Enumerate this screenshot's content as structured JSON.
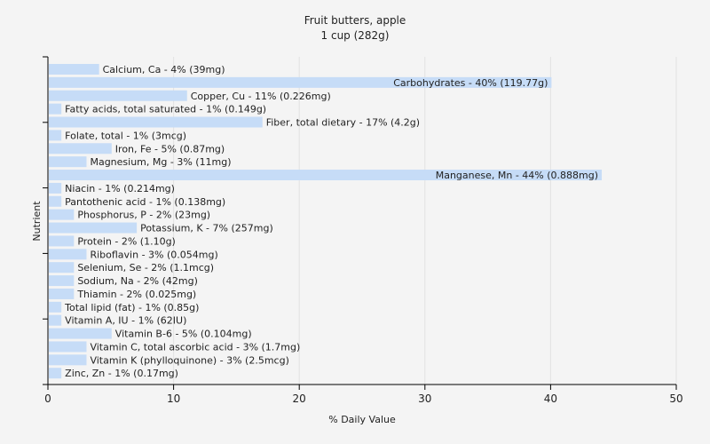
{
  "chart_data": {
    "type": "bar",
    "orientation": "horizontal",
    "title": "Fruit butters, apple",
    "subtitle": "1 cup (282g)",
    "xlabel": "% Daily Value",
    "ylabel": "Nutrient",
    "xlim": [
      0,
      50
    ],
    "xticks": [
      0,
      10,
      20,
      30,
      40,
      50
    ],
    "grid": true,
    "bar_color": "#c6dcf7",
    "categories": [
      "Calcium, Ca",
      "Carbohydrates",
      "Copper, Cu",
      "Fatty acids, total saturated",
      "Fiber, total dietary",
      "Folate, total",
      "Iron, Fe",
      "Magnesium, Mg",
      "Manganese, Mn",
      "Niacin",
      "Pantothenic acid",
      "Phosphorus, P",
      "Potassium, K",
      "Protein",
      "Riboflavin",
      "Selenium, Se",
      "Sodium, Na",
      "Thiamin",
      "Total lipid (fat)",
      "Vitamin A, IU",
      "Vitamin B-6",
      "Vitamin C, total ascorbic acid",
      "Vitamin K (phylloquinone)",
      "Zinc, Zn"
    ],
    "values": [
      4,
      40,
      11,
      1,
      17,
      1,
      5,
      3,
      44,
      1,
      1,
      2,
      7,
      2,
      3,
      2,
      2,
      2,
      1,
      1,
      5,
      3,
      3,
      1
    ],
    "labels": [
      "Calcium, Ca - 4% (39mg)",
      "Carbohydrates - 40% (119.77g)",
      "Copper, Cu - 11% (0.226mg)",
      "Fatty acids, total saturated - 1% (0.149g)",
      "Fiber, total dietary - 17% (4.2g)",
      "Folate, total - 1% (3mcg)",
      "Iron, Fe - 5% (0.87mg)",
      "Magnesium, Mg - 3% (11mg)",
      "Manganese, Mn - 44% (0.888mg)",
      "Niacin - 1% (0.214mg)",
      "Pantothenic acid - 1% (0.138mg)",
      "Phosphorus, P - 2% (23mg)",
      "Potassium, K - 7% (257mg)",
      "Protein - 2% (1.10g)",
      "Riboflavin - 3% (0.054mg)",
      "Selenium, Se - 2% (1.1mcg)",
      "Sodium, Na - 2% (42mg)",
      "Thiamin - 2% (0.025mg)",
      "Total lipid (fat) - 1% (0.85g)",
      "Vitamin A, IU - 1% (62IU)",
      "Vitamin B-6 - 5% (0.104mg)",
      "Vitamin C, total ascorbic acid - 3% (1.7mg)",
      "Vitamin K (phylloquinone) - 3% (2.5mcg)",
      "Zinc, Zn - 1% (0.17mg)"
    ]
  }
}
